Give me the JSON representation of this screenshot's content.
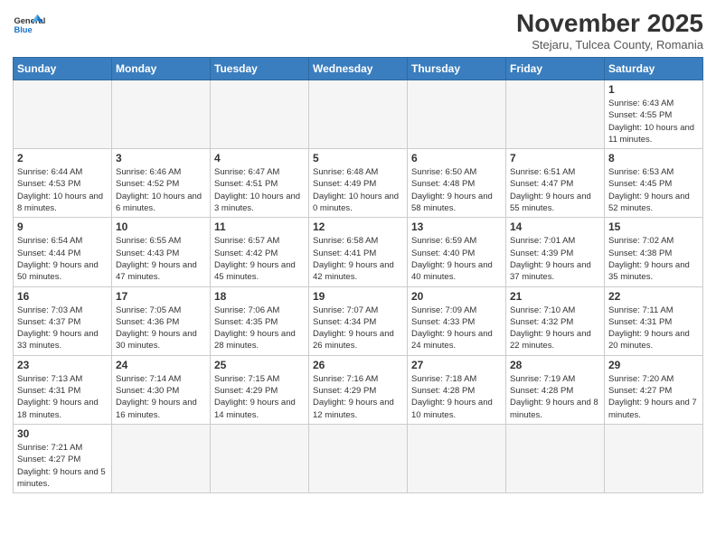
{
  "logo": {
    "text_general": "General",
    "text_blue": "Blue"
  },
  "header": {
    "month_title": "November 2025",
    "subtitle": "Stejaru, Tulcea County, Romania"
  },
  "weekdays": [
    "Sunday",
    "Monday",
    "Tuesday",
    "Wednesday",
    "Thursday",
    "Friday",
    "Saturday"
  ],
  "weeks": [
    [
      {
        "day": "",
        "info": ""
      },
      {
        "day": "",
        "info": ""
      },
      {
        "day": "",
        "info": ""
      },
      {
        "day": "",
        "info": ""
      },
      {
        "day": "",
        "info": ""
      },
      {
        "day": "",
        "info": ""
      },
      {
        "day": "1",
        "info": "Sunrise: 6:43 AM\nSunset: 4:55 PM\nDaylight: 10 hours and 11 minutes."
      }
    ],
    [
      {
        "day": "2",
        "info": "Sunrise: 6:44 AM\nSunset: 4:53 PM\nDaylight: 10 hours and 8 minutes."
      },
      {
        "day": "3",
        "info": "Sunrise: 6:46 AM\nSunset: 4:52 PM\nDaylight: 10 hours and 6 minutes."
      },
      {
        "day": "4",
        "info": "Sunrise: 6:47 AM\nSunset: 4:51 PM\nDaylight: 10 hours and 3 minutes."
      },
      {
        "day": "5",
        "info": "Sunrise: 6:48 AM\nSunset: 4:49 PM\nDaylight: 10 hours and 0 minutes."
      },
      {
        "day": "6",
        "info": "Sunrise: 6:50 AM\nSunset: 4:48 PM\nDaylight: 9 hours and 58 minutes."
      },
      {
        "day": "7",
        "info": "Sunrise: 6:51 AM\nSunset: 4:47 PM\nDaylight: 9 hours and 55 minutes."
      },
      {
        "day": "8",
        "info": "Sunrise: 6:53 AM\nSunset: 4:45 PM\nDaylight: 9 hours and 52 minutes."
      }
    ],
    [
      {
        "day": "9",
        "info": "Sunrise: 6:54 AM\nSunset: 4:44 PM\nDaylight: 9 hours and 50 minutes."
      },
      {
        "day": "10",
        "info": "Sunrise: 6:55 AM\nSunset: 4:43 PM\nDaylight: 9 hours and 47 minutes."
      },
      {
        "day": "11",
        "info": "Sunrise: 6:57 AM\nSunset: 4:42 PM\nDaylight: 9 hours and 45 minutes."
      },
      {
        "day": "12",
        "info": "Sunrise: 6:58 AM\nSunset: 4:41 PM\nDaylight: 9 hours and 42 minutes."
      },
      {
        "day": "13",
        "info": "Sunrise: 6:59 AM\nSunset: 4:40 PM\nDaylight: 9 hours and 40 minutes."
      },
      {
        "day": "14",
        "info": "Sunrise: 7:01 AM\nSunset: 4:39 PM\nDaylight: 9 hours and 37 minutes."
      },
      {
        "day": "15",
        "info": "Sunrise: 7:02 AM\nSunset: 4:38 PM\nDaylight: 9 hours and 35 minutes."
      }
    ],
    [
      {
        "day": "16",
        "info": "Sunrise: 7:03 AM\nSunset: 4:37 PM\nDaylight: 9 hours and 33 minutes."
      },
      {
        "day": "17",
        "info": "Sunrise: 7:05 AM\nSunset: 4:36 PM\nDaylight: 9 hours and 30 minutes."
      },
      {
        "day": "18",
        "info": "Sunrise: 7:06 AM\nSunset: 4:35 PM\nDaylight: 9 hours and 28 minutes."
      },
      {
        "day": "19",
        "info": "Sunrise: 7:07 AM\nSunset: 4:34 PM\nDaylight: 9 hours and 26 minutes."
      },
      {
        "day": "20",
        "info": "Sunrise: 7:09 AM\nSunset: 4:33 PM\nDaylight: 9 hours and 24 minutes."
      },
      {
        "day": "21",
        "info": "Sunrise: 7:10 AM\nSunset: 4:32 PM\nDaylight: 9 hours and 22 minutes."
      },
      {
        "day": "22",
        "info": "Sunrise: 7:11 AM\nSunset: 4:31 PM\nDaylight: 9 hours and 20 minutes."
      }
    ],
    [
      {
        "day": "23",
        "info": "Sunrise: 7:13 AM\nSunset: 4:31 PM\nDaylight: 9 hours and 18 minutes."
      },
      {
        "day": "24",
        "info": "Sunrise: 7:14 AM\nSunset: 4:30 PM\nDaylight: 9 hours and 16 minutes."
      },
      {
        "day": "25",
        "info": "Sunrise: 7:15 AM\nSunset: 4:29 PM\nDaylight: 9 hours and 14 minutes."
      },
      {
        "day": "26",
        "info": "Sunrise: 7:16 AM\nSunset: 4:29 PM\nDaylight: 9 hours and 12 minutes."
      },
      {
        "day": "27",
        "info": "Sunrise: 7:18 AM\nSunset: 4:28 PM\nDaylight: 9 hours and 10 minutes."
      },
      {
        "day": "28",
        "info": "Sunrise: 7:19 AM\nSunset: 4:28 PM\nDaylight: 9 hours and 8 minutes."
      },
      {
        "day": "29",
        "info": "Sunrise: 7:20 AM\nSunset: 4:27 PM\nDaylight: 9 hours and 7 minutes."
      }
    ],
    [
      {
        "day": "30",
        "info": "Sunrise: 7:21 AM\nSunset: 4:27 PM\nDaylight: 9 hours and 5 minutes."
      },
      {
        "day": "",
        "info": ""
      },
      {
        "day": "",
        "info": ""
      },
      {
        "day": "",
        "info": ""
      },
      {
        "day": "",
        "info": ""
      },
      {
        "day": "",
        "info": ""
      },
      {
        "day": "",
        "info": ""
      }
    ]
  ]
}
